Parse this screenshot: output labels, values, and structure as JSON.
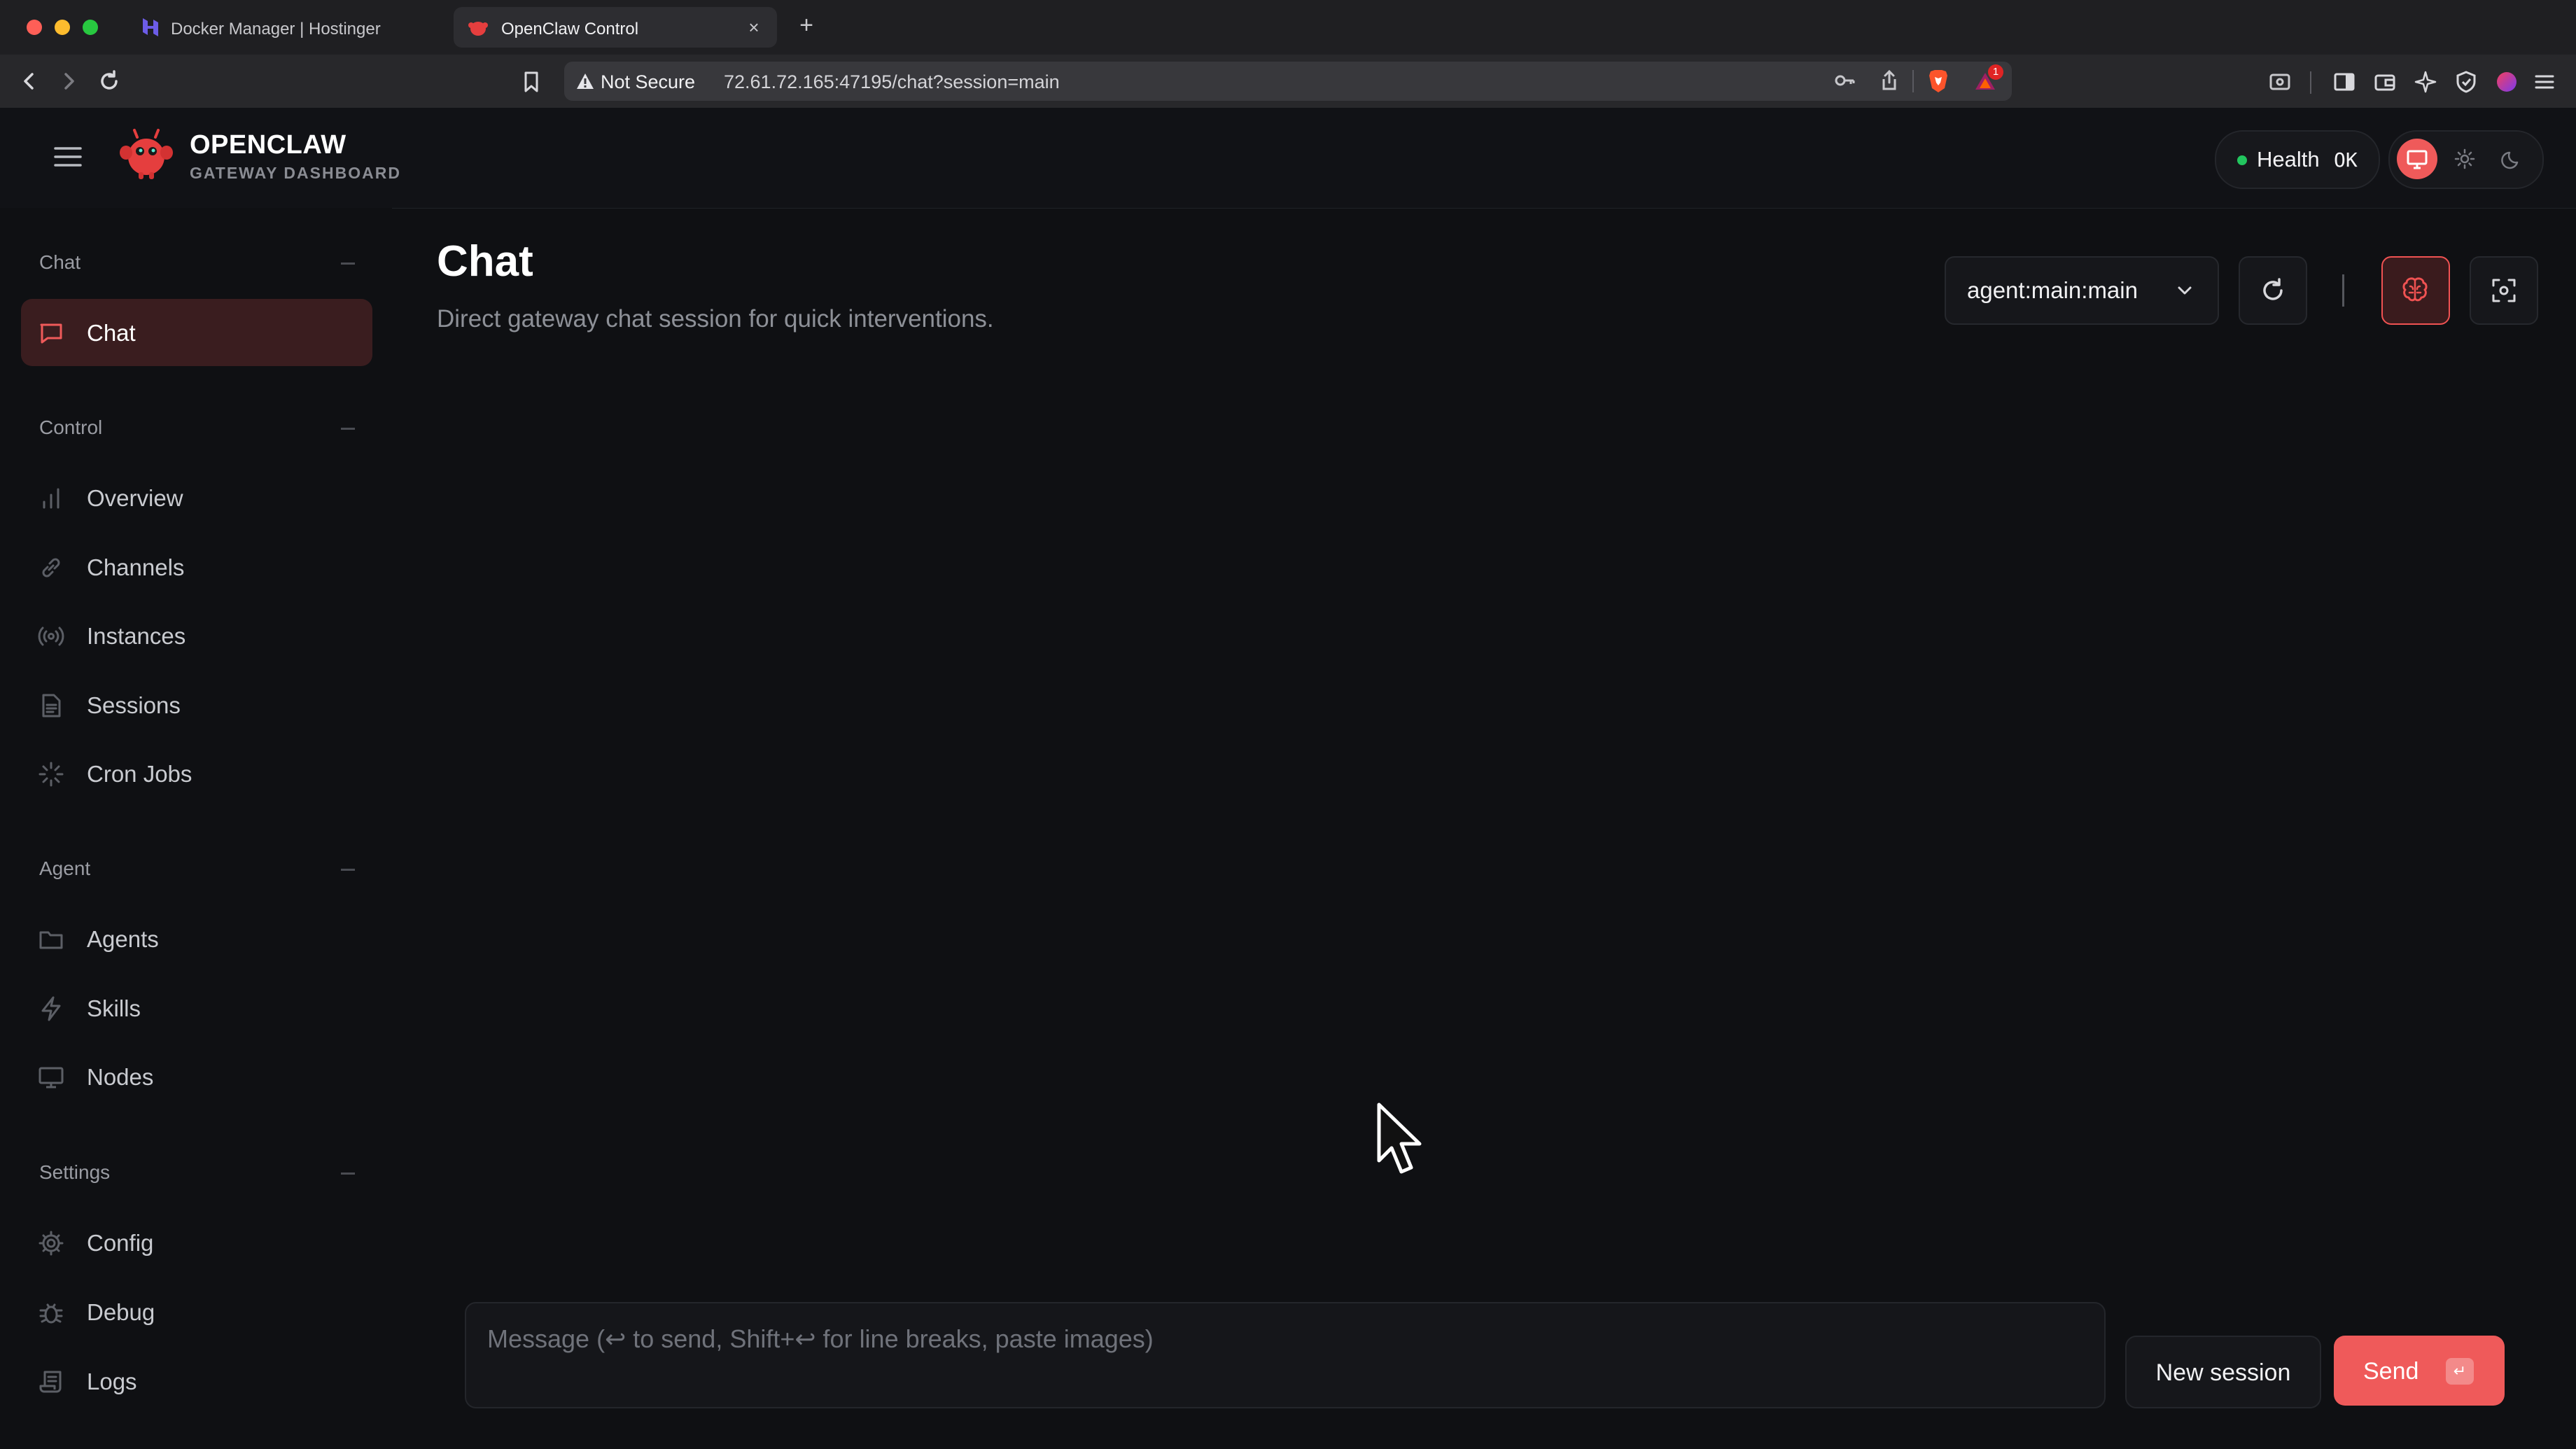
{
  "browser": {
    "tabs": [
      {
        "title": "Docker Manager | Hostinger",
        "icon": "hostinger-icon",
        "active": false
      },
      {
        "title": "OpenClaw Control",
        "icon": "openclaw-icon",
        "active": true
      }
    ],
    "close_glyph": "×",
    "new_tab_glyph": "+",
    "security_label": "Not Secure",
    "url": "72.61.72.165:47195/chat?session=main",
    "shields_badge": "1"
  },
  "header": {
    "brand_title": "OPENCLAW",
    "brand_subtitle": "GATEWAY DASHBOARD",
    "health_label": "Health",
    "health_value": "OK",
    "health_color": "#22c55e"
  },
  "sidebar": {
    "sections": [
      {
        "label": "Chat",
        "items": [
          {
            "label": "Chat",
            "icon": "message-square-icon",
            "active": true
          }
        ]
      },
      {
        "label": "Control",
        "items": [
          {
            "label": "Overview",
            "icon": "bar-chart-icon"
          },
          {
            "label": "Channels",
            "icon": "link-icon"
          },
          {
            "label": "Instances",
            "icon": "radio-broadcast-icon"
          },
          {
            "label": "Sessions",
            "icon": "file-text-icon"
          },
          {
            "label": "Cron Jobs",
            "icon": "loader-icon"
          }
        ]
      },
      {
        "label": "Agent",
        "items": [
          {
            "label": "Agents",
            "icon": "folder-icon"
          },
          {
            "label": "Skills",
            "icon": "zap-icon"
          },
          {
            "label": "Nodes",
            "icon": "monitor-icon"
          }
        ]
      },
      {
        "label": "Settings",
        "items": [
          {
            "label": "Config",
            "icon": "gear-icon"
          },
          {
            "label": "Debug",
            "icon": "bug-icon"
          },
          {
            "label": "Logs",
            "icon": "scroll-icon"
          }
        ]
      }
    ]
  },
  "main": {
    "title": "Chat",
    "subtitle": "Direct gateway chat session for quick interventions.",
    "session_value": "agent:main:main",
    "composer_placeholder": "Message (↩ to send, Shift+↩ for line breaks, paste images)",
    "new_session_label": "New session",
    "send_label": "Send",
    "send_kbd": "↵"
  },
  "colors": {
    "accent": "#ef5a5a",
    "active_nav_bg": "#3a1d1f",
    "background": "#0f1013"
  }
}
